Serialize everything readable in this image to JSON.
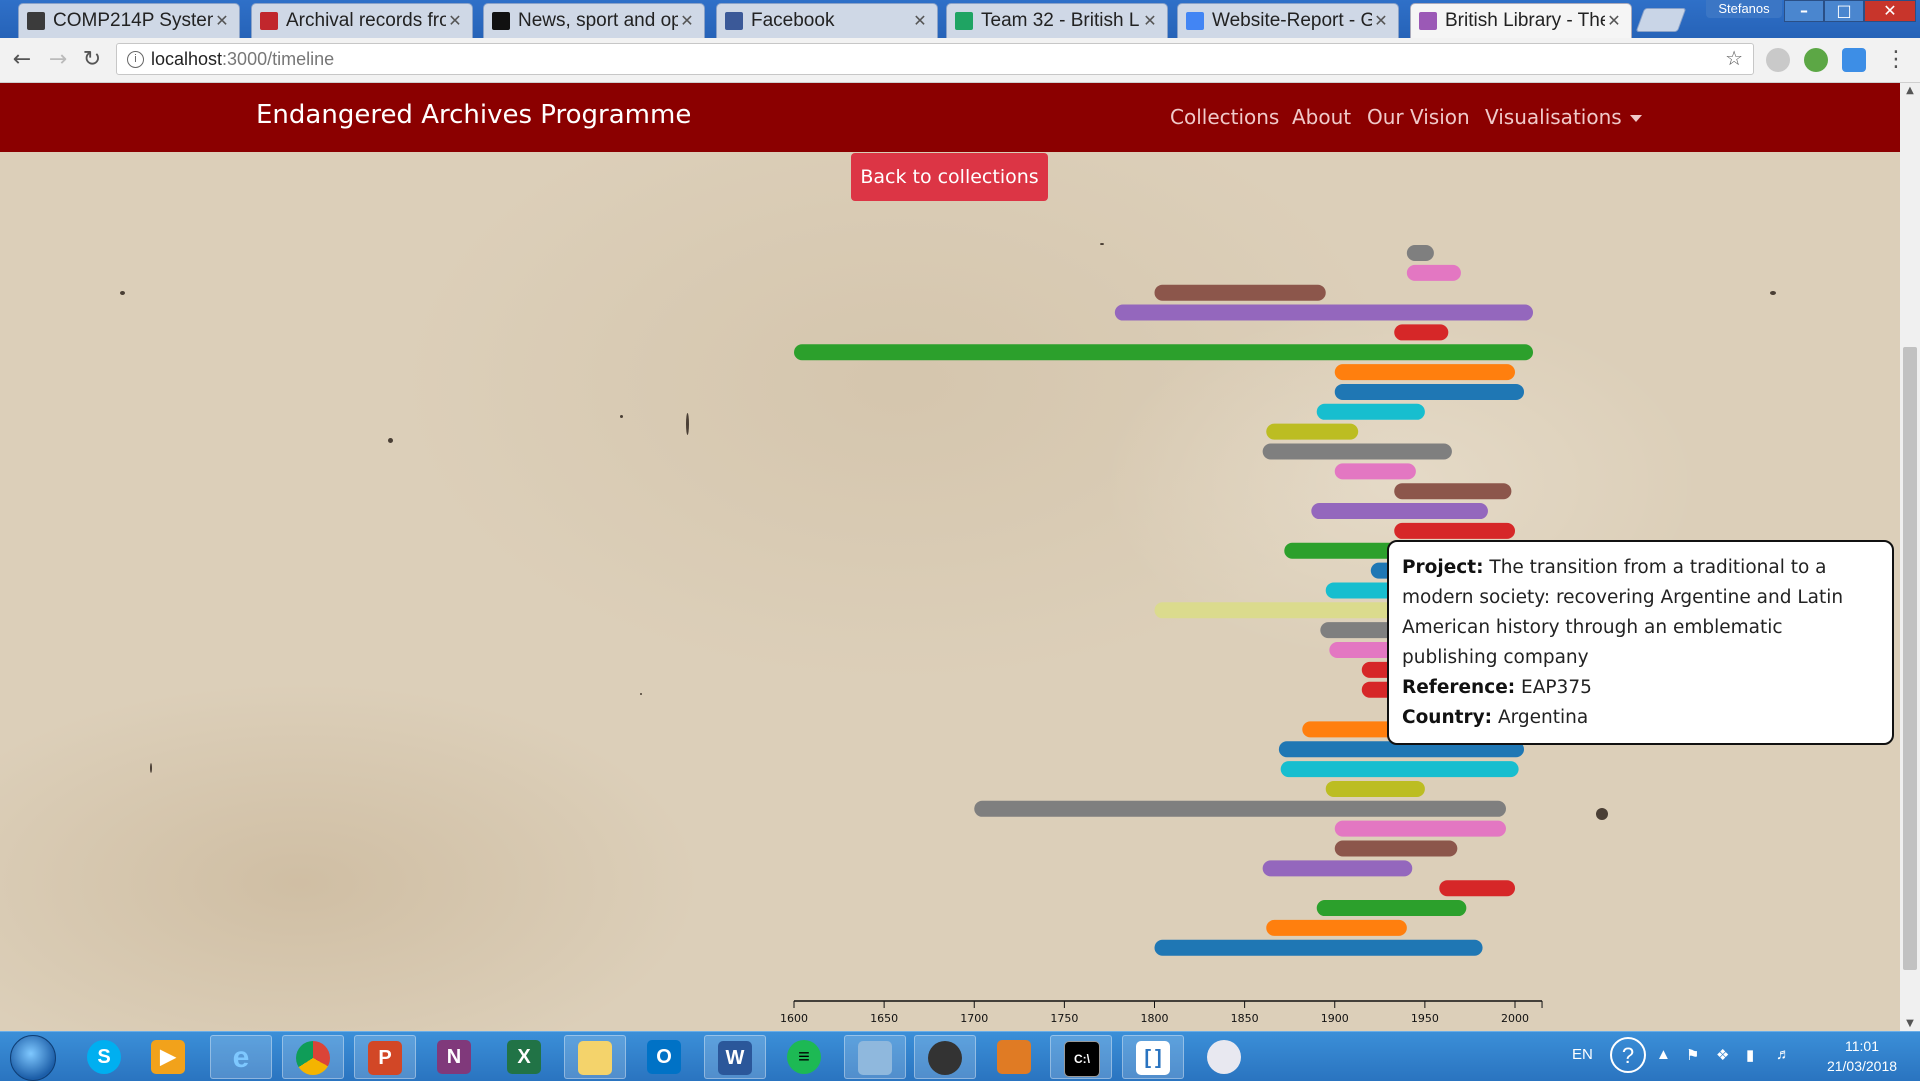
{
  "browser": {
    "tabs": [
      {
        "title": "COMP214P System",
        "favicon_color": "#3b3b3b",
        "active": false
      },
      {
        "title": "Archival records fro",
        "favicon_color": "#c1272d",
        "active": false
      },
      {
        "title": "News, sport and op",
        "favicon_color": "#111111",
        "active": false
      },
      {
        "title": "Facebook",
        "favicon_color": "#3b5998",
        "active": false
      },
      {
        "title": "Team 32 - British L",
        "favicon_color": "#1fa463",
        "active": false
      },
      {
        "title": "Website-Report - G",
        "favicon_color": "#4285f4",
        "active": false
      },
      {
        "title": "British Library - The",
        "favicon_color": "#9b59b6",
        "active": true
      }
    ],
    "profile_name": "Stefanos",
    "url_host": "localhost",
    "url_rest": ":3000/timeline"
  },
  "navbar": {
    "brand": "Endangered Archives Programme",
    "links": [
      "Collections",
      "About",
      "Our Vision",
      "Visualisations"
    ],
    "accent": "#8b0000"
  },
  "back_button": "Back to collections",
  "tooltip": {
    "project_label": "Project:",
    "project_value": "The transition from a traditional to a modern society: recovering Argentine and Latin American history through an emblematic publishing company",
    "reference_label": "Reference:",
    "reference_value": "EAP375",
    "country_label": "Country:",
    "country_value": "Argentina"
  },
  "chart_data": {
    "type": "bar",
    "orientation": "horizontal-range",
    "x_ticks": [
      1600,
      1650,
      1700,
      1750,
      1800,
      1850,
      1900,
      1950,
      2000
    ],
    "xlim": [
      1600,
      2015
    ],
    "ranges": [
      {
        "start": 1940,
        "end": 1955,
        "color": "#7f7f7f"
      },
      {
        "start": 1940,
        "end": 1970,
        "color": "#e377c2"
      },
      {
        "start": 1800,
        "end": 1895,
        "color": "#8c564b"
      },
      {
        "start": 1778,
        "end": 2010,
        "color": "#9467bd"
      },
      {
        "start": 1933,
        "end": 1963,
        "color": "#d62728"
      },
      {
        "start": 1600,
        "end": 2010,
        "color": "#2ca02c"
      },
      {
        "start": 1900,
        "end": 2000,
        "color": "#ff7f0e"
      },
      {
        "start": 1900,
        "end": 2005,
        "color": "#1f77b4"
      },
      {
        "start": 1890,
        "end": 1950,
        "color": "#17becf"
      },
      {
        "start": 1862,
        "end": 1913,
        "color": "#bcbd22"
      },
      {
        "start": 1860,
        "end": 1965,
        "color": "#7f7f7f"
      },
      {
        "start": 1900,
        "end": 1945,
        "color": "#e377c2"
      },
      {
        "start": 1933,
        "end": 1998,
        "color": "#8c564b"
      },
      {
        "start": 1887,
        "end": 1985,
        "color": "#9467bd"
      },
      {
        "start": 1933,
        "end": 2000,
        "color": "#d62728"
      },
      {
        "start": 1872,
        "end": 1950,
        "color": "#2ca02c"
      },
      {
        "start": 1920,
        "end": 1960,
        "color": "#1f77b4"
      },
      {
        "start": 1895,
        "end": 1950,
        "color": "#17becf"
      },
      {
        "start": 1800,
        "end": 1960,
        "color": "#dbdb8d"
      },
      {
        "start": 1892,
        "end": 1945,
        "color": "#7f7f7f"
      },
      {
        "start": 1897,
        "end": 1945,
        "color": "#e377c2"
      },
      {
        "start": 1915,
        "end": 1950,
        "color": "#d62728"
      },
      {
        "start": 1915,
        "end": 1955,
        "color": "#d62728"
      },
      {
        "start": 1930,
        "end": 1973,
        "color": "#2ca02c"
      },
      {
        "start": 1882,
        "end": 1966,
        "color": "#ff7f0e"
      },
      {
        "start": 1869,
        "end": 2005,
        "color": "#1f77b4"
      },
      {
        "start": 1870,
        "end": 2002,
        "color": "#17becf"
      },
      {
        "start": 1895,
        "end": 1950,
        "color": "#bcbd22"
      },
      {
        "start": 1700,
        "end": 1995,
        "color": "#7f7f7f"
      },
      {
        "start": 1900,
        "end": 1995,
        "color": "#e377c2"
      },
      {
        "start": 1900,
        "end": 1968,
        "color": "#8c564b"
      },
      {
        "start": 1860,
        "end": 1943,
        "color": "#9467bd"
      },
      {
        "start": 1958,
        "end": 2000,
        "color": "#d62728"
      },
      {
        "start": 1890,
        "end": 1973,
        "color": "#2ca02c"
      },
      {
        "start": 1862,
        "end": 1940,
        "color": "#ff7f0e"
      },
      {
        "start": 1800,
        "end": 1982,
        "color": "#1f77b4"
      }
    ]
  },
  "taskbar": {
    "language": "EN",
    "time": "11:01",
    "date": "21/03/2018"
  }
}
